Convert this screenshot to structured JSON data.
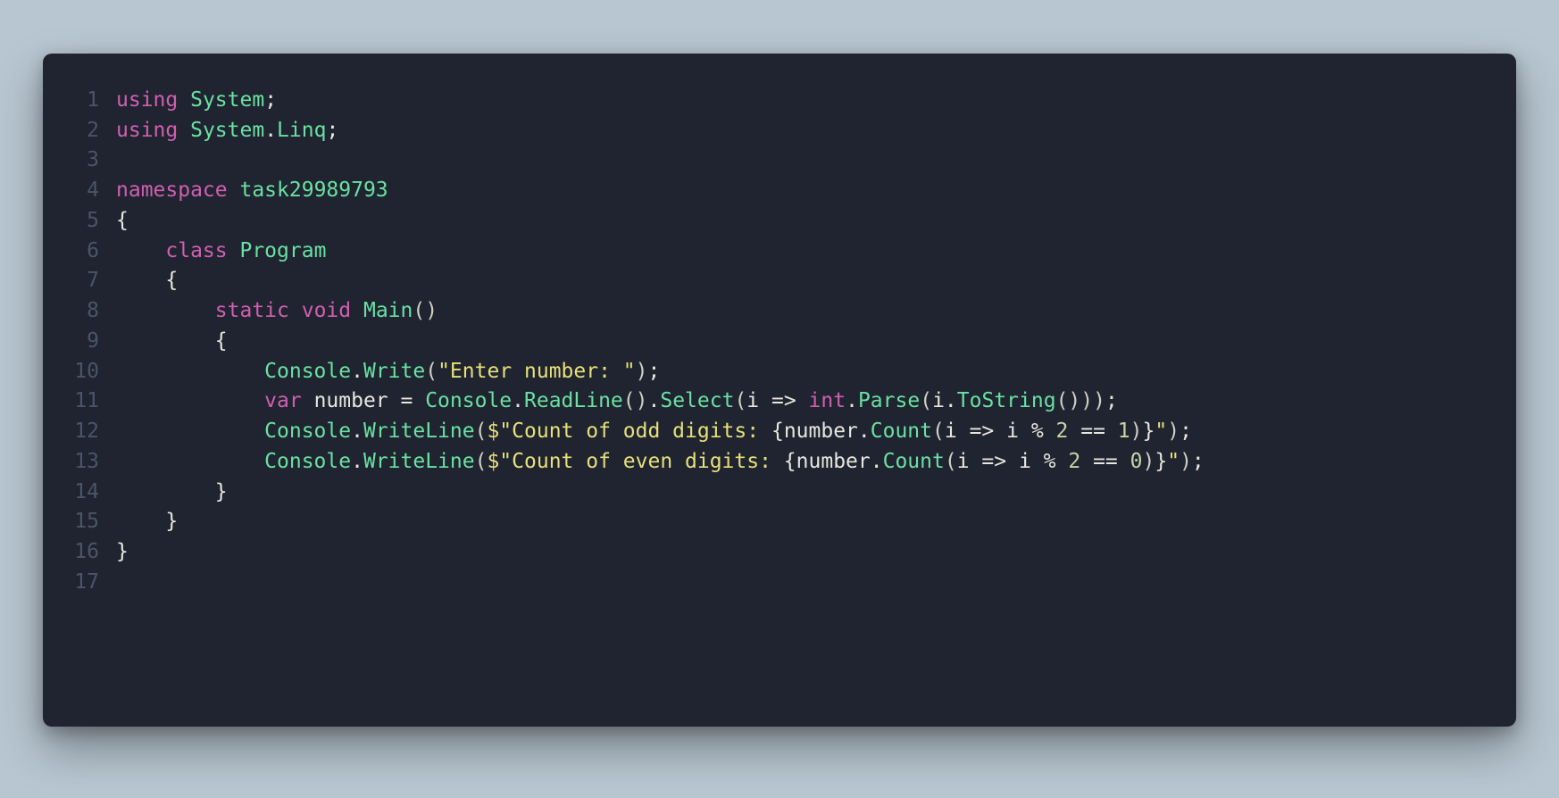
{
  "language": "csharp",
  "colors": {
    "page_bg": "#b8c6d1",
    "editor_bg": "#1f2430",
    "gutter": "#4a5568",
    "keyword": "#d15fb0",
    "type": "#6ae1a2",
    "identifier": "#e8e6df",
    "string": "#e6e07a",
    "number": "#c6d4a6"
  },
  "lines": [
    {
      "n": 1,
      "tokens": [
        {
          "t": "using ",
          "c": "kw"
        },
        {
          "t": "System",
          "c": "type"
        },
        {
          "t": ";",
          "c": "punct"
        }
      ]
    },
    {
      "n": 2,
      "tokens": [
        {
          "t": "using ",
          "c": "kw"
        },
        {
          "t": "System",
          "c": "type"
        },
        {
          "t": ".",
          "c": "punct"
        },
        {
          "t": "Linq",
          "c": "type"
        },
        {
          "t": ";",
          "c": "punct"
        }
      ]
    },
    {
      "n": 3,
      "tokens": [
        {
          "t": "",
          "c": "id"
        }
      ]
    },
    {
      "n": 4,
      "tokens": [
        {
          "t": "namespace ",
          "c": "kw"
        },
        {
          "t": "task29989793",
          "c": "type"
        }
      ]
    },
    {
      "n": 5,
      "tokens": [
        {
          "t": "{",
          "c": "punct"
        }
      ]
    },
    {
      "n": 6,
      "tokens": [
        {
          "t": "    ",
          "c": "id"
        },
        {
          "t": "class ",
          "c": "kw"
        },
        {
          "t": "Program",
          "c": "type"
        }
      ]
    },
    {
      "n": 7,
      "tokens": [
        {
          "t": "    {",
          "c": "punct"
        }
      ]
    },
    {
      "n": 8,
      "tokens": [
        {
          "t": "        ",
          "c": "id"
        },
        {
          "t": "static ",
          "c": "kw"
        },
        {
          "t": "void ",
          "c": "kw"
        },
        {
          "t": "Main",
          "c": "type"
        },
        {
          "t": "()",
          "c": "paren"
        }
      ]
    },
    {
      "n": 9,
      "tokens": [
        {
          "t": "        {",
          "c": "punct"
        }
      ]
    },
    {
      "n": 10,
      "tokens": [
        {
          "t": "            ",
          "c": "id"
        },
        {
          "t": "Console",
          "c": "type"
        },
        {
          "t": ".",
          "c": "punct"
        },
        {
          "t": "Write",
          "c": "type"
        },
        {
          "t": "(",
          "c": "paren"
        },
        {
          "t": "\"Enter number: \"",
          "c": "str"
        },
        {
          "t": ")",
          "c": "paren"
        },
        {
          "t": ";",
          "c": "punct"
        }
      ]
    },
    {
      "n": 11,
      "tokens": [
        {
          "t": "            ",
          "c": "id"
        },
        {
          "t": "var ",
          "c": "kw"
        },
        {
          "t": "number ",
          "c": "id"
        },
        {
          "t": "= ",
          "c": "punct"
        },
        {
          "t": "Console",
          "c": "type"
        },
        {
          "t": ".",
          "c": "punct"
        },
        {
          "t": "ReadLine",
          "c": "type"
        },
        {
          "t": "()",
          "c": "paren"
        },
        {
          "t": ".",
          "c": "punct"
        },
        {
          "t": "Select",
          "c": "type"
        },
        {
          "t": "(",
          "c": "paren"
        },
        {
          "t": "i ",
          "c": "id"
        },
        {
          "t": "=> ",
          "c": "punct"
        },
        {
          "t": "int",
          "c": "kw"
        },
        {
          "t": ".",
          "c": "punct"
        },
        {
          "t": "Parse",
          "c": "type"
        },
        {
          "t": "(",
          "c": "paren"
        },
        {
          "t": "i",
          "c": "id"
        },
        {
          "t": ".",
          "c": "punct"
        },
        {
          "t": "ToString",
          "c": "type"
        },
        {
          "t": "()",
          "c": "paren"
        },
        {
          "t": ")",
          "c": "paren"
        },
        {
          "t": ")",
          "c": "paren"
        },
        {
          "t": ";",
          "c": "punct"
        }
      ]
    },
    {
      "n": 12,
      "tokens": [
        {
          "t": "            ",
          "c": "id"
        },
        {
          "t": "Console",
          "c": "type"
        },
        {
          "t": ".",
          "c": "punct"
        },
        {
          "t": "WriteLine",
          "c": "type"
        },
        {
          "t": "(",
          "c": "paren"
        },
        {
          "t": "$\"Count of odd digits: ",
          "c": "str"
        },
        {
          "t": "{",
          "c": "punct"
        },
        {
          "t": "number",
          "c": "id"
        },
        {
          "t": ".",
          "c": "punct"
        },
        {
          "t": "Count",
          "c": "type"
        },
        {
          "t": "(",
          "c": "paren"
        },
        {
          "t": "i ",
          "c": "id"
        },
        {
          "t": "=> ",
          "c": "punct"
        },
        {
          "t": "i ",
          "c": "id"
        },
        {
          "t": "% ",
          "c": "punct"
        },
        {
          "t": "2 ",
          "c": "num"
        },
        {
          "t": "== ",
          "c": "punct"
        },
        {
          "t": "1",
          "c": "num"
        },
        {
          "t": ")",
          "c": "paren"
        },
        {
          "t": "}",
          "c": "punct"
        },
        {
          "t": "\"",
          "c": "str"
        },
        {
          "t": ")",
          "c": "paren"
        },
        {
          "t": ";",
          "c": "punct"
        }
      ]
    },
    {
      "n": 13,
      "tokens": [
        {
          "t": "            ",
          "c": "id"
        },
        {
          "t": "Console",
          "c": "type"
        },
        {
          "t": ".",
          "c": "punct"
        },
        {
          "t": "WriteLine",
          "c": "type"
        },
        {
          "t": "(",
          "c": "paren"
        },
        {
          "t": "$\"Count of even digits: ",
          "c": "str"
        },
        {
          "t": "{",
          "c": "punct"
        },
        {
          "t": "number",
          "c": "id"
        },
        {
          "t": ".",
          "c": "punct"
        },
        {
          "t": "Count",
          "c": "type"
        },
        {
          "t": "(",
          "c": "paren"
        },
        {
          "t": "i ",
          "c": "id"
        },
        {
          "t": "=> ",
          "c": "punct"
        },
        {
          "t": "i ",
          "c": "id"
        },
        {
          "t": "% ",
          "c": "punct"
        },
        {
          "t": "2 ",
          "c": "num"
        },
        {
          "t": "== ",
          "c": "punct"
        },
        {
          "t": "0",
          "c": "num"
        },
        {
          "t": ")",
          "c": "paren"
        },
        {
          "t": "}",
          "c": "punct"
        },
        {
          "t": "\"",
          "c": "str"
        },
        {
          "t": ")",
          "c": "paren"
        },
        {
          "t": ";",
          "c": "punct"
        }
      ]
    },
    {
      "n": 14,
      "tokens": [
        {
          "t": "        }",
          "c": "punct"
        }
      ]
    },
    {
      "n": 15,
      "tokens": [
        {
          "t": "    }",
          "c": "punct"
        }
      ]
    },
    {
      "n": 16,
      "tokens": [
        {
          "t": "}",
          "c": "punct"
        }
      ]
    },
    {
      "n": 17,
      "tokens": [
        {
          "t": "",
          "c": "id"
        }
      ]
    }
  ]
}
